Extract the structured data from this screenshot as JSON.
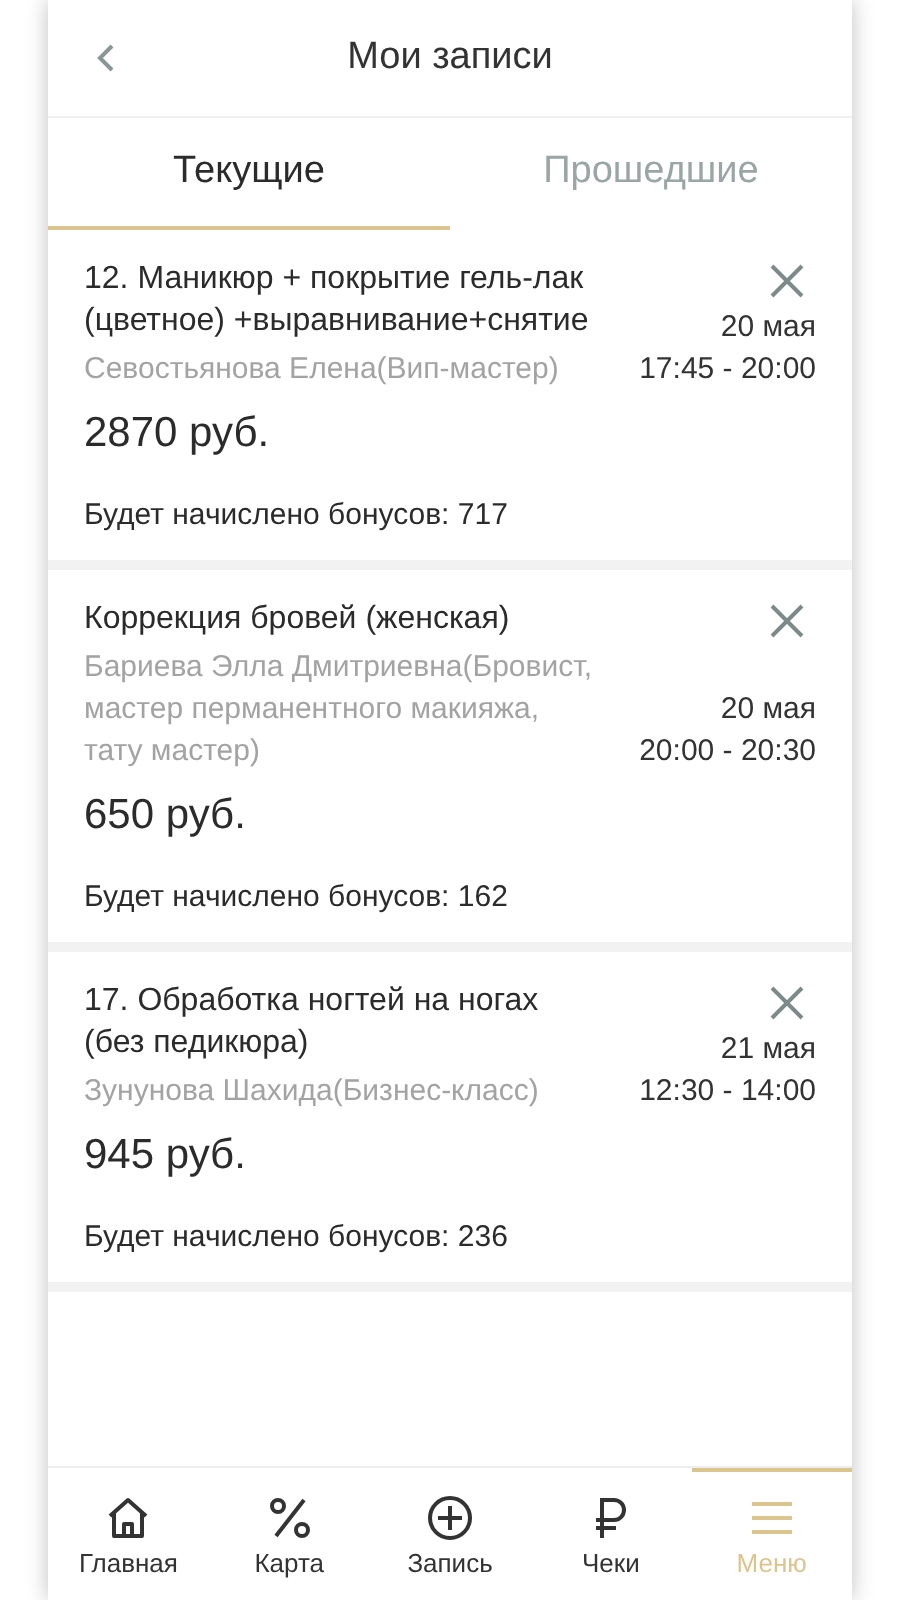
{
  "header": {
    "title": "Мои записи"
  },
  "tabs": [
    {
      "label": "Текущие",
      "selected": true
    },
    {
      "label": "Прошедшие",
      "selected": false
    }
  ],
  "appointments": [
    {
      "service": "12. Маникюр + покрытие гель-лак (цветное) +выравнивание+снятие",
      "master": "Севостьянова Елена(Вип-мастер)",
      "date": "20 мая",
      "time": "17:45 - 20:00",
      "price": "2870 руб.",
      "bonus": "Будет начислено бонусов: 717"
    },
    {
      "service": "Коррекция бровей (женская)",
      "master": "Бариева Элла Дмитриевна(Бровист, мастер перманентного макияжа, тату мастер)",
      "date": "20 мая",
      "time": "20:00 - 20:30",
      "price": "650 руб.",
      "bonus": "Будет начислено бонусов: 162"
    },
    {
      "service": "17. Обработка ногтей на ногах (без педикюра)",
      "master": "Зунунова Шахида(Бизнес-класс)",
      "date": "21 мая",
      "time": "12:30 - 14:00",
      "price": "945 руб.",
      "bonus": "Будет начислено бонусов: 236"
    }
  ],
  "nav": [
    {
      "kind": "home",
      "label": "Главная",
      "selected": false
    },
    {
      "kind": "percent",
      "label": "Карта",
      "selected": false
    },
    {
      "kind": "plus",
      "label": "Запись",
      "selected": false
    },
    {
      "kind": "ruble",
      "label": "Чеки",
      "selected": false
    },
    {
      "kind": "menu",
      "label": "Меню",
      "selected": true
    }
  ]
}
